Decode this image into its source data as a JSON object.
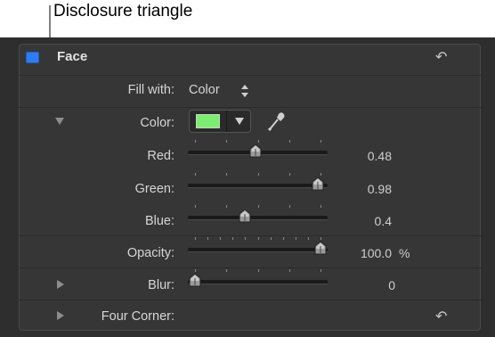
{
  "callout": {
    "text": "Disclosure triangle"
  },
  "header": {
    "title": "Face",
    "checked": true,
    "reset_icon": "undo-arrow-icon"
  },
  "fill_with": {
    "label": "Fill with:",
    "value": "Color"
  },
  "color": {
    "label": "Color:",
    "swatch_hex": "#7aee6f",
    "eyedropper_icon": "eyedropper-icon"
  },
  "red": {
    "label": "Red:",
    "value": "0.48",
    "fraction": 0.48
  },
  "green": {
    "label": "Green:",
    "value": "0.98",
    "fraction": 0.98
  },
  "blue": {
    "label": "Blue:",
    "value": "0.4",
    "fraction": 0.4
  },
  "opacity": {
    "label": "Opacity:",
    "value": "100.0",
    "unit": "%",
    "fraction": 1.0
  },
  "blur": {
    "label": "Blur:",
    "value": "0",
    "fraction": 0.0
  },
  "four_corner": {
    "label": "Four Corner:",
    "reset_icon": "undo-arrow-icon"
  },
  "colors": {
    "panel": "#363636",
    "checkbox": "#2f7bf2",
    "swatch": "#7aee6f"
  }
}
